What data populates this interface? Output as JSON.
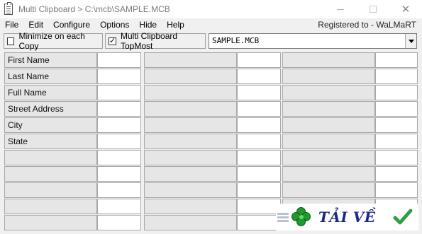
{
  "window": {
    "title": "Multi Clipboard > C:\\mcb\\SAMPLE.MCB",
    "controls": {
      "minimize": "─",
      "maximize": "☐",
      "close": "✕"
    }
  },
  "menu": {
    "items": [
      "File",
      "Edit",
      "Configure",
      "Options",
      "Hide",
      "Help"
    ],
    "registered": "Registered to - WaLMaRT"
  },
  "toolbar": {
    "minimize_on_copy": {
      "label": "Minimize on each Copy",
      "checked": false
    },
    "topmost": {
      "label": "Multi Clipboard TopMost",
      "checked": true
    },
    "file_select": {
      "value": "SAMPLE.MCB"
    }
  },
  "grid": {
    "labels": [
      "First Name",
      "Last Name",
      "Full Name",
      "Street Address",
      "City",
      "State",
      "",
      "",
      "",
      "",
      ""
    ]
  },
  "watermark": {
    "text": "TẢI VỀ",
    "colors": {
      "text": "#1a2a8a",
      "clover": "#1f9a2e",
      "check": "#2ea043"
    }
  },
  "icons": {
    "app": "clipboard-icon",
    "dropdown": "chevron-down-icon",
    "watermark_check": "checkmark-icon",
    "watermark_clover": "clover-icon"
  }
}
